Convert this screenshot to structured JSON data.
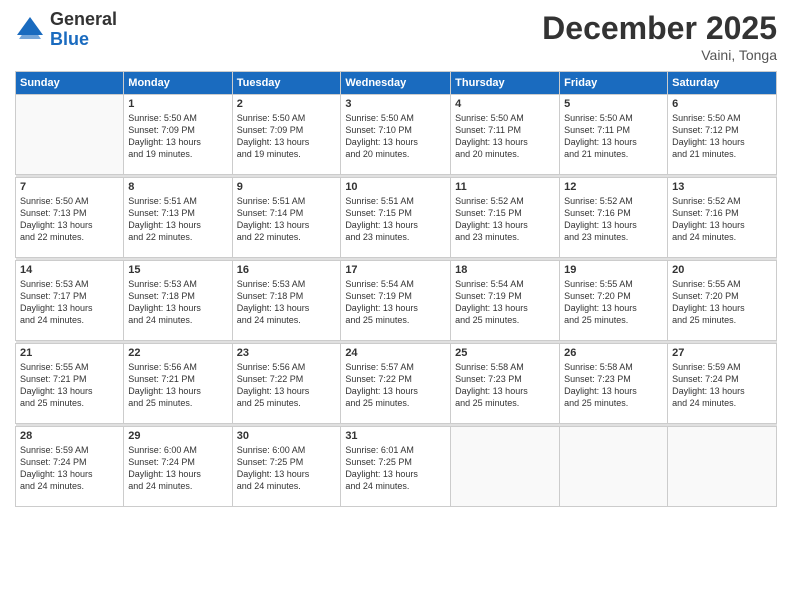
{
  "logo": {
    "general": "General",
    "blue": "Blue"
  },
  "header": {
    "month": "December 2025",
    "location": "Vaini, Tonga"
  },
  "weekdays": [
    "Sunday",
    "Monday",
    "Tuesday",
    "Wednesday",
    "Thursday",
    "Friday",
    "Saturday"
  ],
  "weeks": [
    [
      {
        "day": "",
        "info": ""
      },
      {
        "day": "1",
        "info": "Sunrise: 5:50 AM\nSunset: 7:09 PM\nDaylight: 13 hours\nand 19 minutes."
      },
      {
        "day": "2",
        "info": "Sunrise: 5:50 AM\nSunset: 7:09 PM\nDaylight: 13 hours\nand 19 minutes."
      },
      {
        "day": "3",
        "info": "Sunrise: 5:50 AM\nSunset: 7:10 PM\nDaylight: 13 hours\nand 20 minutes."
      },
      {
        "day": "4",
        "info": "Sunrise: 5:50 AM\nSunset: 7:11 PM\nDaylight: 13 hours\nand 20 minutes."
      },
      {
        "day": "5",
        "info": "Sunrise: 5:50 AM\nSunset: 7:11 PM\nDaylight: 13 hours\nand 21 minutes."
      },
      {
        "day": "6",
        "info": "Sunrise: 5:50 AM\nSunset: 7:12 PM\nDaylight: 13 hours\nand 21 minutes."
      }
    ],
    [
      {
        "day": "7",
        "info": "Sunrise: 5:50 AM\nSunset: 7:13 PM\nDaylight: 13 hours\nand 22 minutes."
      },
      {
        "day": "8",
        "info": "Sunrise: 5:51 AM\nSunset: 7:13 PM\nDaylight: 13 hours\nand 22 minutes."
      },
      {
        "day": "9",
        "info": "Sunrise: 5:51 AM\nSunset: 7:14 PM\nDaylight: 13 hours\nand 22 minutes."
      },
      {
        "day": "10",
        "info": "Sunrise: 5:51 AM\nSunset: 7:15 PM\nDaylight: 13 hours\nand 23 minutes."
      },
      {
        "day": "11",
        "info": "Sunrise: 5:52 AM\nSunset: 7:15 PM\nDaylight: 13 hours\nand 23 minutes."
      },
      {
        "day": "12",
        "info": "Sunrise: 5:52 AM\nSunset: 7:16 PM\nDaylight: 13 hours\nand 23 minutes."
      },
      {
        "day": "13",
        "info": "Sunrise: 5:52 AM\nSunset: 7:16 PM\nDaylight: 13 hours\nand 24 minutes."
      }
    ],
    [
      {
        "day": "14",
        "info": "Sunrise: 5:53 AM\nSunset: 7:17 PM\nDaylight: 13 hours\nand 24 minutes."
      },
      {
        "day": "15",
        "info": "Sunrise: 5:53 AM\nSunset: 7:18 PM\nDaylight: 13 hours\nand 24 minutes."
      },
      {
        "day": "16",
        "info": "Sunrise: 5:53 AM\nSunset: 7:18 PM\nDaylight: 13 hours\nand 24 minutes."
      },
      {
        "day": "17",
        "info": "Sunrise: 5:54 AM\nSunset: 7:19 PM\nDaylight: 13 hours\nand 25 minutes."
      },
      {
        "day": "18",
        "info": "Sunrise: 5:54 AM\nSunset: 7:19 PM\nDaylight: 13 hours\nand 25 minutes."
      },
      {
        "day": "19",
        "info": "Sunrise: 5:55 AM\nSunset: 7:20 PM\nDaylight: 13 hours\nand 25 minutes."
      },
      {
        "day": "20",
        "info": "Sunrise: 5:55 AM\nSunset: 7:20 PM\nDaylight: 13 hours\nand 25 minutes."
      }
    ],
    [
      {
        "day": "21",
        "info": "Sunrise: 5:55 AM\nSunset: 7:21 PM\nDaylight: 13 hours\nand 25 minutes."
      },
      {
        "day": "22",
        "info": "Sunrise: 5:56 AM\nSunset: 7:21 PM\nDaylight: 13 hours\nand 25 minutes."
      },
      {
        "day": "23",
        "info": "Sunrise: 5:56 AM\nSunset: 7:22 PM\nDaylight: 13 hours\nand 25 minutes."
      },
      {
        "day": "24",
        "info": "Sunrise: 5:57 AM\nSunset: 7:22 PM\nDaylight: 13 hours\nand 25 minutes."
      },
      {
        "day": "25",
        "info": "Sunrise: 5:58 AM\nSunset: 7:23 PM\nDaylight: 13 hours\nand 25 minutes."
      },
      {
        "day": "26",
        "info": "Sunrise: 5:58 AM\nSunset: 7:23 PM\nDaylight: 13 hours\nand 25 minutes."
      },
      {
        "day": "27",
        "info": "Sunrise: 5:59 AM\nSunset: 7:24 PM\nDaylight: 13 hours\nand 24 minutes."
      }
    ],
    [
      {
        "day": "28",
        "info": "Sunrise: 5:59 AM\nSunset: 7:24 PM\nDaylight: 13 hours\nand 24 minutes."
      },
      {
        "day": "29",
        "info": "Sunrise: 6:00 AM\nSunset: 7:24 PM\nDaylight: 13 hours\nand 24 minutes."
      },
      {
        "day": "30",
        "info": "Sunrise: 6:00 AM\nSunset: 7:25 PM\nDaylight: 13 hours\nand 24 minutes."
      },
      {
        "day": "31",
        "info": "Sunrise: 6:01 AM\nSunset: 7:25 PM\nDaylight: 13 hours\nand 24 minutes."
      },
      {
        "day": "",
        "info": ""
      },
      {
        "day": "",
        "info": ""
      },
      {
        "day": "",
        "info": ""
      }
    ]
  ]
}
